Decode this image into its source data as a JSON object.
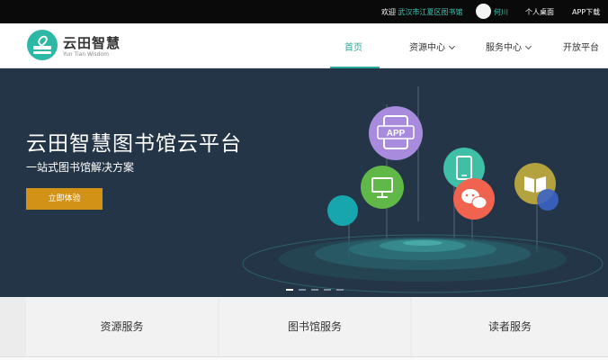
{
  "topbar": {
    "welcome_prefix": "欢迎",
    "library_name": "武汉市江夏区图书馆",
    "user_name": "何川",
    "personal_center": "个人桌面",
    "app_download": "APP下载"
  },
  "brand": {
    "name_cn": "云田智慧",
    "name_en": "Yun Tian Wisdom"
  },
  "nav": {
    "items": [
      {
        "label": "首页",
        "active": true
      },
      {
        "label": "资源中心",
        "dropdown": true
      },
      {
        "label": "服务中心",
        "dropdown": true
      },
      {
        "label": "开放平台"
      }
    ]
  },
  "banner": {
    "title": "云田智慧图书馆云平台",
    "subtitle": "一站式图书馆解决方案",
    "cta_label": "立即体验",
    "app_icon_text": "APP",
    "slide_count": 5,
    "active_slide": 1,
    "colors": {
      "background": "#243547",
      "cta": "#d29117",
      "app_bubble": "#a88bdc",
      "monitor_bubble": "#5fb847",
      "phone_bubble": "#3fbfa6",
      "wechat_bubble": "#f0634f",
      "book_bubble": "#b3a23d",
      "teal_bubble": "#17a6ad",
      "blue_bubble": "#3a64c4"
    }
  },
  "services": [
    {
      "label": "资源服务"
    },
    {
      "label": "图书馆服务"
    },
    {
      "label": "读者服务"
    }
  ],
  "accent_color": "#2aa99a"
}
